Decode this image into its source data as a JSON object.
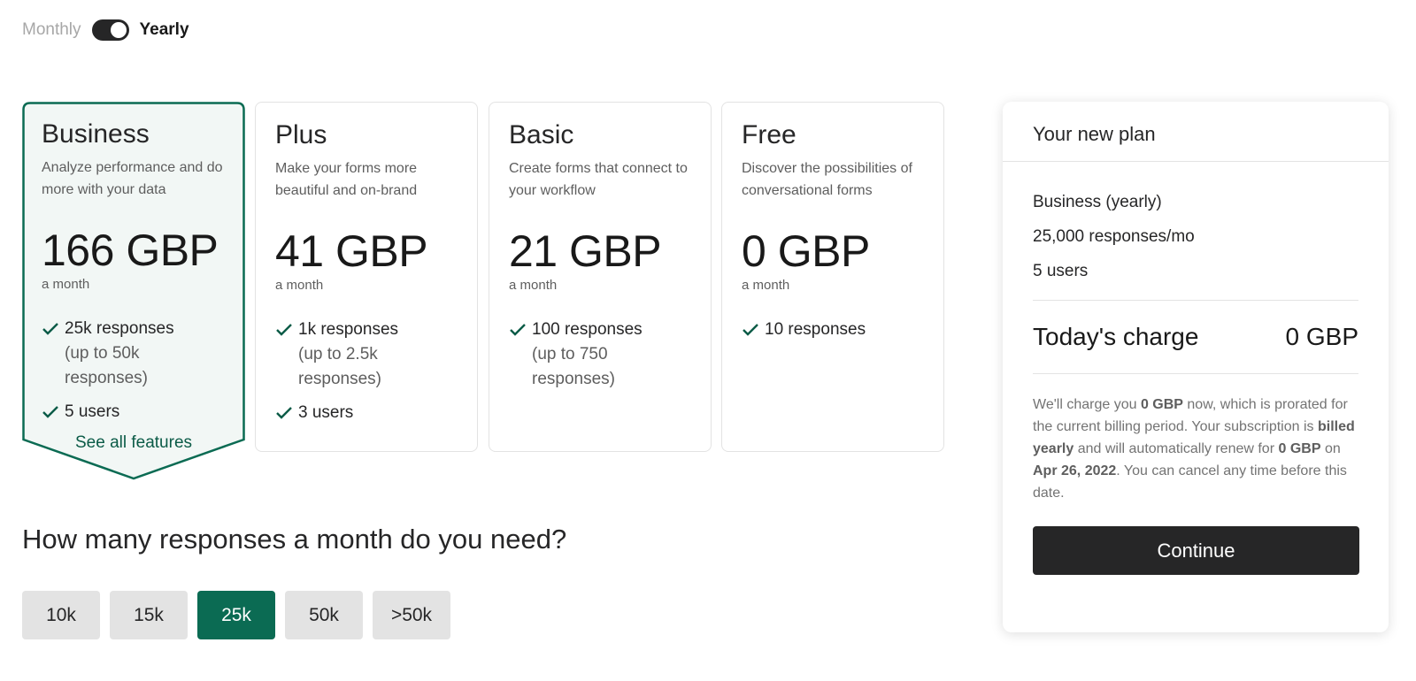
{
  "billing": {
    "monthly_label": "Monthly",
    "yearly_label": "Yearly",
    "selected": "yearly"
  },
  "plans": [
    {
      "name": "Business",
      "description": "Analyze performance and do more with your data",
      "price": "166 GBP",
      "period": "a month",
      "features": [
        {
          "text": "25k responses",
          "sub": "(up to 50k responses)"
        },
        {
          "text": "5 users",
          "sub": ""
        }
      ],
      "see_all_label": "See all features",
      "selected": true
    },
    {
      "name": "Plus",
      "description": "Make your forms more beautiful and on-brand",
      "price": "41 GBP",
      "period": "a month",
      "features": [
        {
          "text": "1k responses",
          "sub": "(up to 2.5k responses)"
        },
        {
          "text": "3 users",
          "sub": ""
        }
      ]
    },
    {
      "name": "Basic",
      "description": "Create forms that connect to your workflow",
      "price": "21 GBP",
      "period": "a month",
      "features": [
        {
          "text": "100 responses",
          "sub": "(up to 750 responses)"
        }
      ]
    },
    {
      "name": "Free",
      "description": "Discover the possibilities of conversational forms",
      "price": "0 GBP",
      "period": "a month",
      "features": [
        {
          "text": "10 responses",
          "sub": ""
        }
      ]
    }
  ],
  "question": "How many responses a month do you need?",
  "response_options": [
    "10k",
    "15k",
    "25k",
    "50k",
    ">50k"
  ],
  "selected_response_option": "25k",
  "summary": {
    "title": "Your new plan",
    "plan_line": "Business (yearly)",
    "responses_line": "25,000 responses/mo",
    "users_line": "5 users",
    "charge_label": "Today's charge",
    "charge_value": "0 GBP",
    "note": {
      "t1": "We'll charge you ",
      "b1": "0 GBP",
      "t2": " now, which is prorated for the current billing period. Your subscription is ",
      "b2": "billed yearly",
      "t3": " and will automatically renew for ",
      "b3": "0 GBP",
      "t4": " on ",
      "b4": "Apr 26, 2022",
      "t5": ". You can cancel any time before this date."
    },
    "continue_label": "Continue"
  },
  "colors": {
    "accent": "#0b6b53",
    "accent_text": "#0b5b47",
    "selected_card_bg": "#f2f7f5",
    "dark": "#262627",
    "chip_bg": "#e3e3e3"
  },
  "icons": {
    "feature": "check-icon"
  }
}
